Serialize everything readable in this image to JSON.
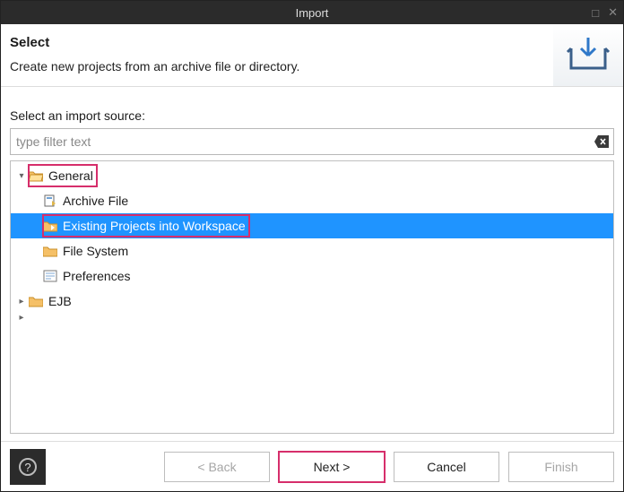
{
  "window": {
    "title": "Import"
  },
  "header": {
    "title": "Select",
    "subtitle": "Create new projects from an archive file or directory."
  },
  "filter": {
    "label": "Select an import source:",
    "placeholder": "type filter text",
    "value": ""
  },
  "tree": {
    "nodes": [
      {
        "label": "General",
        "kind": "folder",
        "expanded": true,
        "highlight": true
      },
      {
        "label": "Archive File",
        "kind": "item",
        "child": true
      },
      {
        "label": "Existing Projects into Workspace",
        "kind": "item",
        "child": true,
        "selected": true,
        "highlight": true
      },
      {
        "label": "File System",
        "kind": "item",
        "child": true
      },
      {
        "label": "Preferences",
        "kind": "item",
        "child": true
      },
      {
        "label": "EJB",
        "kind": "folder",
        "expanded": false
      }
    ]
  },
  "buttons": {
    "back": "< Back",
    "next": "Next >",
    "cancel": "Cancel",
    "finish": "Finish"
  }
}
